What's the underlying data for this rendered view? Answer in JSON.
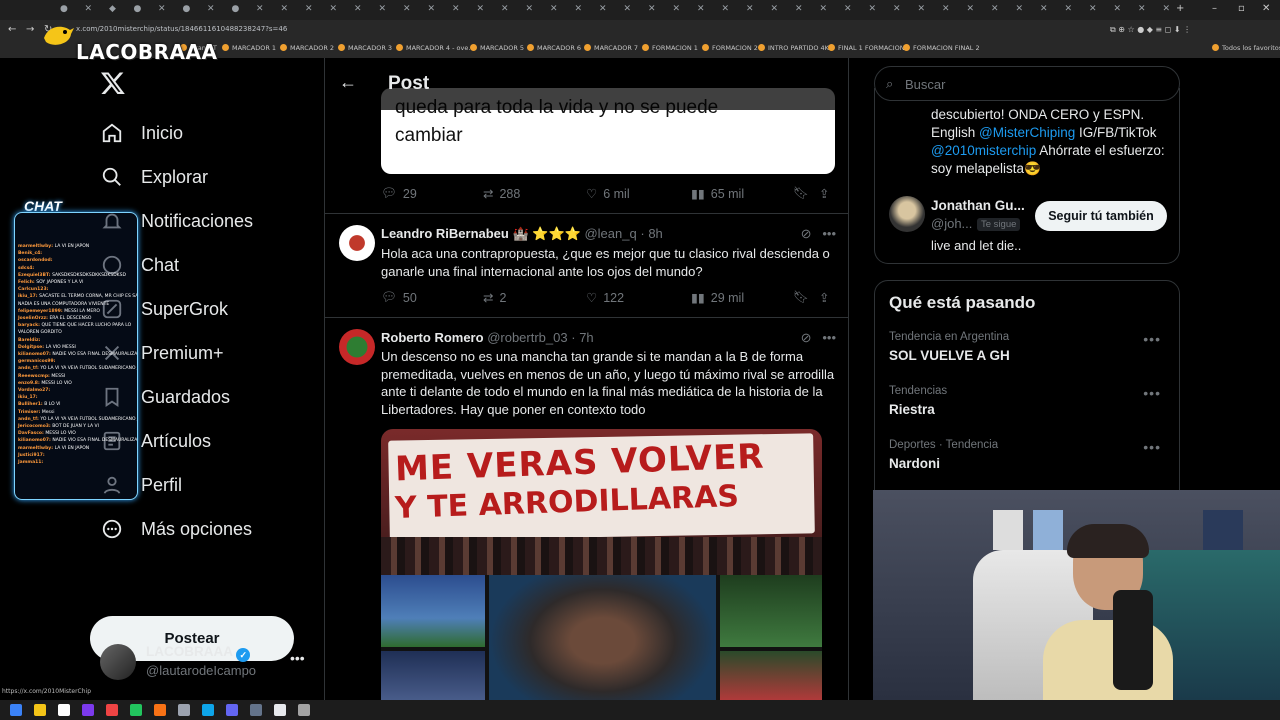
{
  "browser": {
    "url": "x.com/2010misterchip/status/1846611610488238247?s=46",
    "bookmarks": [
      "Gran DT",
      "MARCADOR 1",
      "MARCADOR 2",
      "MARCADOR 3",
      "MARCADOR 4 - ove...",
      "MARCADOR 5",
      "MARCADOR 6",
      "MARCADOR 7",
      "FORMACION 1",
      "FORMACION 2",
      "INTRO PARTIDO 4K",
      "FINAL 1 FORMACION",
      "FORMACION FINAL 2"
    ],
    "all_bookmarks": "Todos los favoritos",
    "status_link": "https://x.com/2010MisterChip"
  },
  "overlay": {
    "logo_text": "LACOBRAAA",
    "chat_title": "CHAT",
    "chat_lines": [
      {
        "user": "marmeltlwby",
        "msg": "LA VI EN JAPON"
      },
      {
        "user": "Benik_c4",
        "msg": ""
      },
      {
        "user": "oscardondod",
        "msg": ""
      },
      {
        "user": "sdcs4",
        "msg": ""
      },
      {
        "user": "Ezequiel3BT",
        "msg": "SAKSDKSDKSDKSDKKSDKSDKSD"
      },
      {
        "user": "Felich",
        "msg": "SOY JAPONES Y LA VI"
      },
      {
        "user": "Carlcun123",
        "msg": ""
      },
      {
        "user": "ikiu_17",
        "msg": "SACASTE EL TERMO CORNA, MR CHIP ES SAN"
      },
      {
        "user": "",
        "msg": "NADIA ES UNA COMPUTADORA VIVIENTE"
      },
      {
        "user": "felipemeyer1899",
        "msg": "MESSI LA MERO"
      },
      {
        "user": "JoselinOrzz",
        "msg": "ERA EL DESCENSO"
      },
      {
        "user": "baryack",
        "msg": "QUE TIENE QUE HACER LUCHO PARA LO"
      },
      {
        "user": "",
        "msg": "VALOREN GORDITO"
      },
      {
        "user": "Bareldiz",
        "msg": ""
      },
      {
        "user": "Dolgitpse",
        "msg": "LA VIO MESSI"
      },
      {
        "user": "kilianomo07",
        "msg": "NADIE VIO ESA FINAL DESMAURALIZADA"
      },
      {
        "user": "germanicos99",
        "msg": ""
      },
      {
        "user": "andn_tf",
        "msg": "YO LA VI YA VEIA FUTBOL SUDAMERICANO JAJAJA"
      },
      {
        "user": "Reeewscmp",
        "msg": "MESSI"
      },
      {
        "user": "enzo9.8",
        "msg": "MESSI LO VIO"
      },
      {
        "user": "Vordalmo27",
        "msg": ""
      },
      {
        "user": "ikiu_17",
        "msg": ""
      },
      {
        "user": "Bulliher1",
        "msg": "B LO VI"
      },
      {
        "user": "Trimiser",
        "msg": "Messi"
      },
      {
        "user": "andn_tf",
        "msg": "YO LA VI YA VEIA FUTBOL SUDAMERICANO JAJAJA"
      },
      {
        "user": "Jericocomo3",
        "msg": "BOT DE JUAN Y LA VI"
      },
      {
        "user": "DavFasco",
        "msg": "MESSI LO VIO"
      },
      {
        "user": "kilianomo07",
        "msg": "NADIE VIO ESA FINAL DESMAURALIZADA"
      },
      {
        "user": "marmeltlwby",
        "msg": "LA VI EN JAPON"
      },
      {
        "user": "Justici917",
        "msg": ""
      },
      {
        "user": "Jamma11",
        "msg": ""
      }
    ]
  },
  "sidebar": {
    "nav": [
      {
        "label": "Inicio",
        "icon": "home-icon"
      },
      {
        "label": "Explorar",
        "icon": "search-icon"
      },
      {
        "label": "Notificaciones",
        "icon": "bell-icon"
      },
      {
        "label": "Chat",
        "icon": "chat-icon"
      },
      {
        "label": "SuperGrok",
        "icon": "grok-icon"
      },
      {
        "label": "Premium+",
        "icon": "x-premium-icon"
      },
      {
        "label": "Guardados",
        "icon": "bookmark-icon"
      },
      {
        "label": "Artículos",
        "icon": "article-icon"
      },
      {
        "label": "Perfil",
        "icon": "user-icon"
      },
      {
        "label": "Más opciones",
        "icon": "more-circle-icon"
      }
    ],
    "post_button": "Postear",
    "account": {
      "name": "LACOBRAAA",
      "handle": "@lautarodeIcampo"
    }
  },
  "center": {
    "title": "Post",
    "quote_text": [
      "queda para toda la vida y no se puede",
      "cambiar"
    ],
    "main_actions": {
      "replies": "29",
      "reposts": "288",
      "likes": "6 mil",
      "views": "65 mil"
    },
    "replies": [
      {
        "name": "Leandro RiBernabeu",
        "badges": "🏰 ⭐⭐⭐",
        "handle": "@lean_q",
        "time": "8h",
        "text": "Hola aca una contrapropuesta, ¿que es mejor que tu clasico rival descienda o ganarle una final internacional ante los ojos del mundo?",
        "replies": "50",
        "reposts": "2",
        "likes": "122",
        "views": "29 mil"
      },
      {
        "name": "Roberto Romero",
        "handle": "@robertrb_03",
        "time": "7h",
        "text": "Un descenso no es una mancha tan grande si te mandan a la B de forma premeditada, vuelves en menos de un año, y luego tú máximo rival se arrodilla ante ti delante de todo el mundo en la final más mediática de la historia de la Libertadores. Hay que poner en contexto todo",
        "banner_text": [
          "ME VERAS VOLVER",
          "Y TE ARRODILLARAS"
        ]
      }
    ]
  },
  "right": {
    "search_placeholder": "Buscar",
    "bio_lines": [
      "descubierto! ONDA CERO y ESPN.",
      "English ",
      "@MisterChiping",
      " IG/FB/TikTok",
      "@2010misterchip",
      " Ahórrate el esfuerzo:",
      "soy melapelista😎"
    ],
    "suggest": {
      "name": "Jonathan Gu...",
      "handle": "@joh...",
      "follows_you": "Te sigue",
      "button": "Seguir tú también",
      "bio": "live and let die.."
    },
    "trending_title": "Qué está pasando",
    "trends": [
      {
        "category": "Tendencia en Argentina",
        "name": "SOL VUELVE A GH"
      },
      {
        "category": "Tendencias",
        "name": "Riestra"
      },
      {
        "category": "Deportes · Tendencia",
        "name": "Nardoni"
      }
    ]
  },
  "colors": {
    "link": "#1d9bf0",
    "verified": "#1d9bf0",
    "muted": "#71767b"
  }
}
